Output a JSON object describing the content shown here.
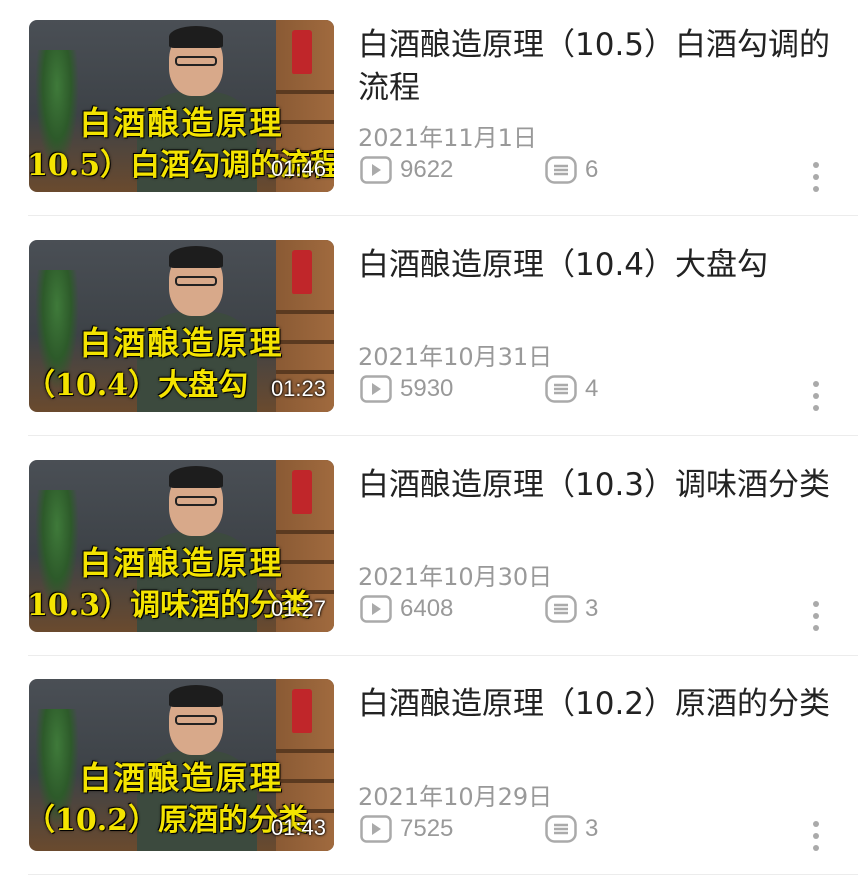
{
  "videos": [
    {
      "title": "白酒酿造原理（10.5）白酒勾调的流程",
      "date": "2021年11月1日",
      "views": "9622",
      "comments": "6",
      "duration": "01:46",
      "thumb_caption_top": "白酒酿造原理",
      "thumb_caption_bottom": "10.5）白酒勾调的流程"
    },
    {
      "title": "白酒酿造原理（10.4）大盘勾",
      "date": "2021年10月31日",
      "views": "5930",
      "comments": "4",
      "duration": "01:23",
      "thumb_caption_top": "白酒酿造原理",
      "thumb_caption_bottom": "（10.4）大盘勾"
    },
    {
      "title": "白酒酿造原理（10.3）调味酒分类",
      "date": "2021年10月30日",
      "views": "6408",
      "comments": "3",
      "duration": "01:27",
      "thumb_caption_top": "白酒酿造原理",
      "thumb_caption_bottom": "10.3）调味酒的分类"
    },
    {
      "title": "白酒酿造原理（10.2）原酒的分类",
      "date": "2021年10月29日",
      "views": "7525",
      "comments": "3",
      "duration": "01:43",
      "thumb_caption_top": "白酒酿造原理",
      "thumb_caption_bottom": "（10.2）原酒的分类"
    }
  ],
  "colors": {
    "caption": "#f4e400",
    "meta_text": "#999999",
    "title_text": "#222222"
  },
  "icons": {
    "views": "play-icon",
    "comments": "comment-list-icon",
    "more": "more-vertical-icon"
  }
}
